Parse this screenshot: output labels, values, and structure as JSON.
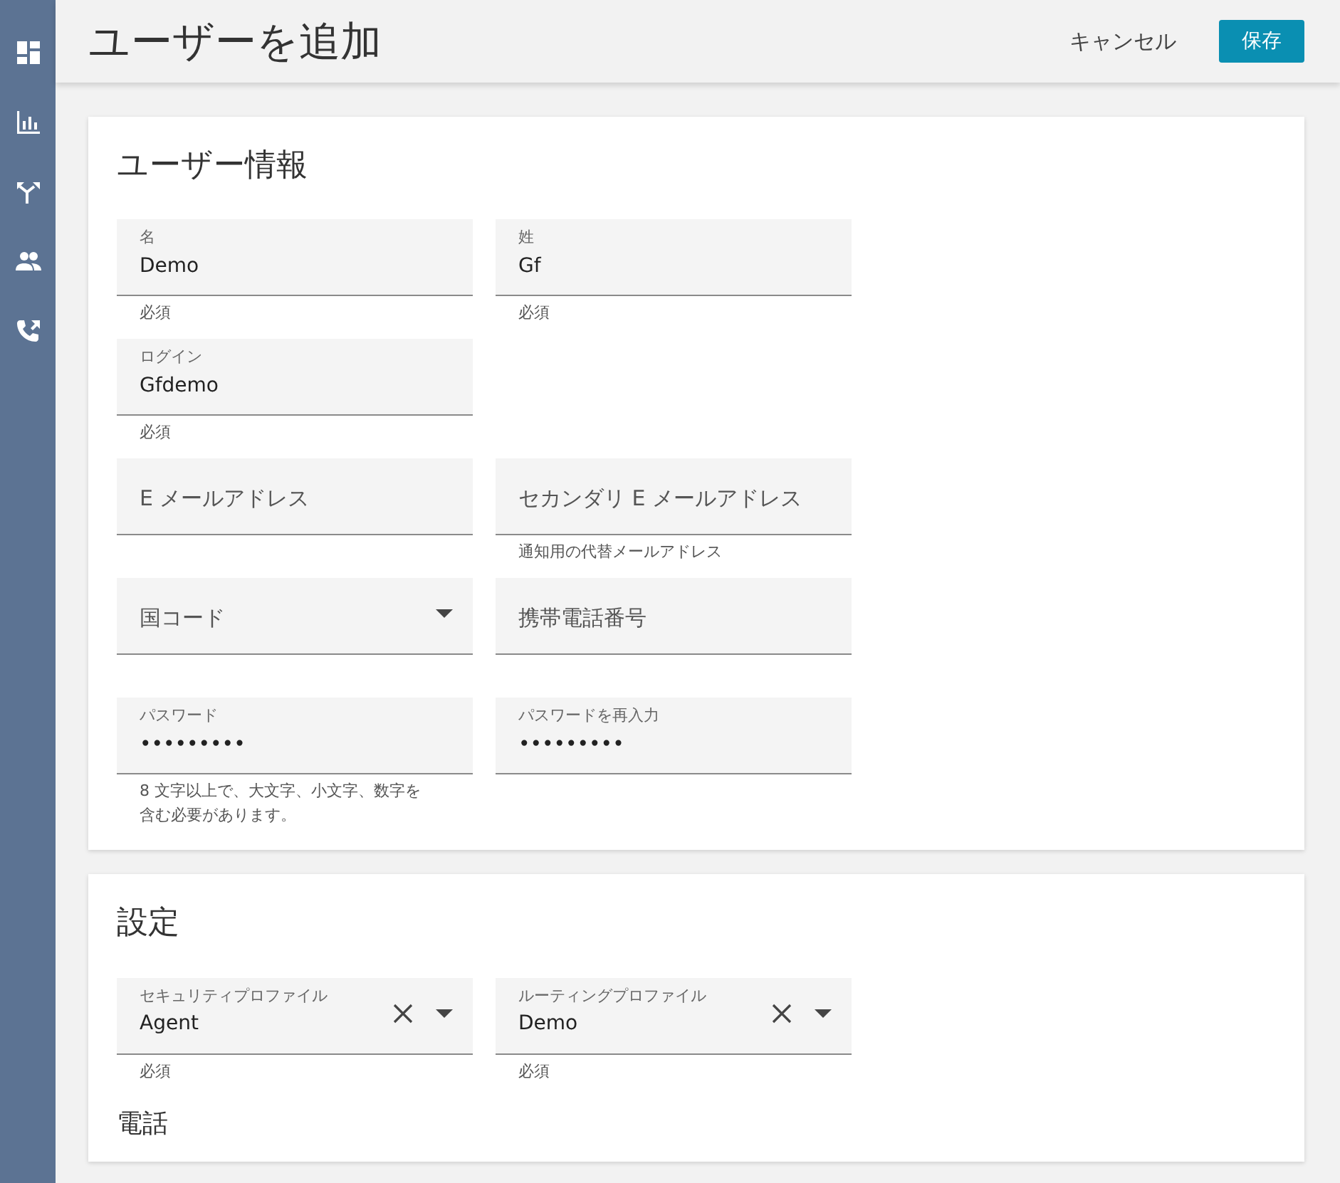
{
  "sidebar": {
    "items": [
      {
        "kind": "dashboard",
        "selected": false
      },
      {
        "kind": "chart",
        "selected": false
      },
      {
        "kind": "routing",
        "selected": false
      },
      {
        "kind": "users",
        "selected": false
      },
      {
        "kind": "phone",
        "selected": false
      }
    ]
  },
  "header": {
    "title": "ユーザーを追加",
    "cancel": "キャンセル",
    "save": "保存"
  },
  "sections": [
    {
      "title": "ユーザー情報",
      "rows": [
        [
          {
            "kind": "text",
            "label": "名",
            "value": "Demo",
            "helper": "必須"
          },
          {
            "kind": "text",
            "label": "姓",
            "value": "Gf",
            "helper": "必須"
          }
        ],
        [
          {
            "kind": "text",
            "label": "ログイン",
            "value": "Gfdemo",
            "helper": "必須"
          }
        ],
        [
          {
            "kind": "text",
            "label": "E メールアドレス"
          },
          {
            "kind": "text",
            "label": "セカンダリ E メールアドレス",
            "helper": "通知用の代替メールアドレス"
          }
        ],
        [
          {
            "kind": "select",
            "label": "国コード"
          },
          {
            "kind": "text",
            "label": "携帯電話番号"
          }
        ],
        [
          {
            "kind": "password",
            "label": "パスワード",
            "value": "•••••••••",
            "helper": "8 文字以上で、大文字、小文字、数字を含む必要があります。"
          },
          {
            "kind": "password",
            "label": "パスワードを再入力",
            "value": "•••••••••"
          }
        ]
      ]
    },
    {
      "title": "設定",
      "rows": [
        [
          {
            "kind": "clearable_select",
            "label": "セキュリティプロファイル",
            "value": "Agent",
            "helper": "必須"
          },
          {
            "kind": "clearable_select",
            "label": "ルーティングプロファイル",
            "value": "Demo",
            "helper": "必須"
          }
        ]
      ],
      "subtitle": "電話"
    }
  ]
}
